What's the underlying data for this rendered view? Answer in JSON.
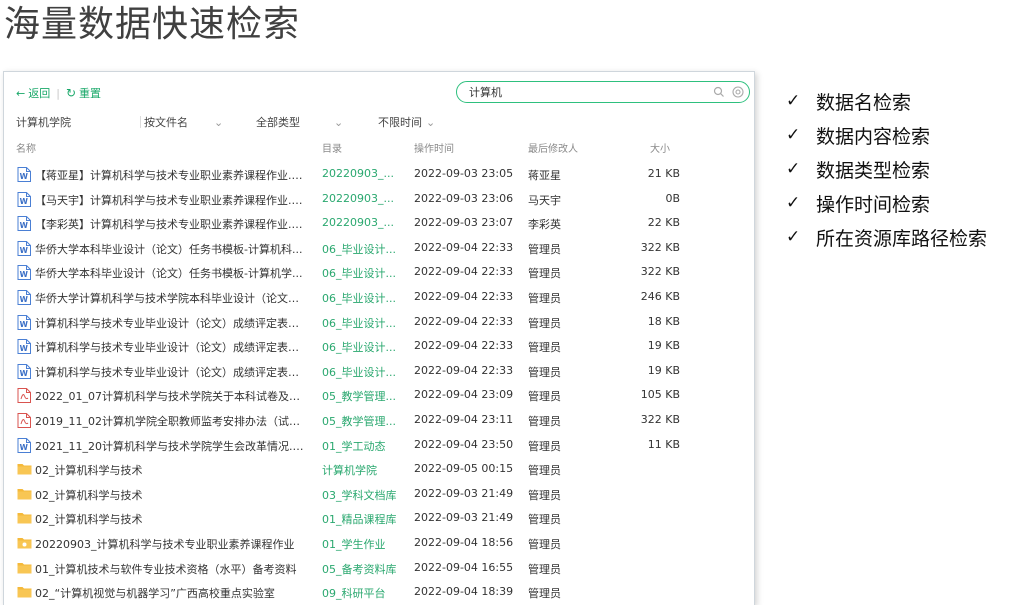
{
  "slide": {
    "title": "海量数据快速检索",
    "features": [
      "数据名检索",
      "数据内容检索",
      "数据类型检索",
      "操作时间检索",
      "所在资源库路径检索"
    ]
  },
  "toolbar": {
    "back_label": "返回",
    "reset_label": "重置",
    "accent_color": "#1aa86a"
  },
  "search": {
    "value": "计算机",
    "placeholder": ""
  },
  "filters": {
    "scope": "计算机学院",
    "by": "按文件名",
    "type": "全部类型",
    "time": "不限时间"
  },
  "columns": {
    "name": "名称",
    "dir": "目录",
    "time": "操作时间",
    "modifier": "最后修改人",
    "size": "大小"
  },
  "rows": [
    {
      "icon": "word",
      "name": "【蒋亚星】计算机科学与技术专业职业素养课程作业.d...",
      "dir": "20220903_...",
      "time": "2022-09-03 23:05",
      "modifier": "蒋亚星",
      "size": "21 KB"
    },
    {
      "icon": "word",
      "name": "【马天宇】计算机科学与技术专业职业素养课程作业.d...",
      "dir": "20220903_...",
      "time": "2022-09-03 23:06",
      "modifier": "马天宇",
      "size": "0B"
    },
    {
      "icon": "word",
      "name": "【李彩英】计算机科学与技术专业职业素养课程作业.d...",
      "dir": "20220903_...",
      "time": "2022-09-03 23:07",
      "modifier": "李彩英",
      "size": "22 KB"
    },
    {
      "icon": "word",
      "name": "华侨大学本科毕业设计（论文）任务书模板-计算机科...",
      "dir": "06_毕业设计...",
      "time": "2022-09-04 22:33",
      "modifier": "管理员",
      "size": "322 KB"
    },
    {
      "icon": "word",
      "name": "华侨大学本科毕业设计（论文）任务书模板-计算机学...",
      "dir": "06_毕业设计...",
      "time": "2022-09-04 22:33",
      "modifier": "管理员",
      "size": "322 KB"
    },
    {
      "icon": "word",
      "name": "华侨大学计算机科学与技术学院本科毕业设计（论文）...",
      "dir": "06_毕业设计...",
      "time": "2022-09-04 22:33",
      "modifier": "管理员",
      "size": "246 KB"
    },
    {
      "icon": "word",
      "name": "计算机科学与技术专业毕业设计（论文）成绩评定表（...",
      "dir": "06_毕业设计...",
      "time": "2022-09-04 22:33",
      "modifier": "管理员",
      "size": "18 KB"
    },
    {
      "icon": "word",
      "name": "计算机科学与技术专业毕业设计（论文）成绩评定表（...",
      "dir": "06_毕业设计...",
      "time": "2022-09-04 22:33",
      "modifier": "管理员",
      "size": "19 KB"
    },
    {
      "icon": "word",
      "name": "计算机科学与技术专业毕业设计（论文）成绩评定表（...",
      "dir": "06_毕业设计...",
      "time": "2022-09-04 22:33",
      "modifier": "管理员",
      "size": "19 KB"
    },
    {
      "icon": "pdf",
      "name": "2022_01_07计算机科学与技术学院关于本科试卷及相...",
      "dir": "05_教学管理...",
      "time": "2022-09-04 23:09",
      "modifier": "管理员",
      "size": "105 KB"
    },
    {
      "icon": "pdf",
      "name": "2019_11_02计算机学院全职教师监考安排办法（试行...",
      "dir": "05_教学管理...",
      "time": "2022-09-04 23:11",
      "modifier": "管理员",
      "size": "322 KB"
    },
    {
      "icon": "word",
      "name": "2021_11_20计算机科学与技术学院学生会改革情况.docx",
      "dir": "01_学工动态",
      "time": "2022-09-04 23:50",
      "modifier": "管理员",
      "size": "11 KB"
    },
    {
      "icon": "folder",
      "name": "02_计算机科学与技术",
      "dir": "计算机学院",
      "time": "2022-09-05 00:15",
      "modifier": "管理员",
      "size": ""
    },
    {
      "icon": "folder",
      "name": "02_计算机科学与技术",
      "dir": "03_学科文档库",
      "time": "2022-09-03 21:49",
      "modifier": "管理员",
      "size": ""
    },
    {
      "icon": "folder",
      "name": "02_计算机科学与技术",
      "dir": "01_精品课程库",
      "time": "2022-09-03 21:49",
      "modifier": "管理员",
      "size": ""
    },
    {
      "icon": "folder-shared",
      "name": "20220903_计算机科学与技术专业职业素养课程作业",
      "dir": "01_学生作业",
      "time": "2022-09-04 18:56",
      "modifier": "管理员",
      "size": ""
    },
    {
      "icon": "folder",
      "name": "01_计算机技术与软件专业技术资格（水平）备考资料",
      "dir": "05_备考资料库",
      "time": "2022-09-04 16:55",
      "modifier": "管理员",
      "size": ""
    },
    {
      "icon": "folder",
      "name": "02_“计算机视觉与机器学习”广西高校重点实验室",
      "dir": "09_科研平台",
      "time": "2022-09-04 18:39",
      "modifier": "管理员",
      "size": ""
    }
  ]
}
